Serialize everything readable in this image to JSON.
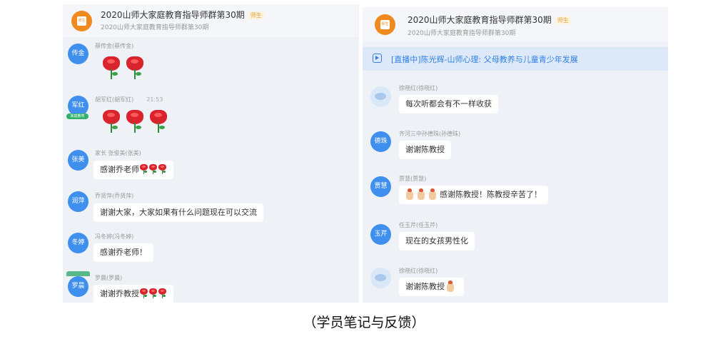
{
  "left_panel": {
    "header": {
      "title": "2020山师大家庭教育指导师群第30期",
      "badge": "师生",
      "subtitle": "2020山师大家庭教育指导师群第30期"
    },
    "messages": [
      {
        "avatar": "传金",
        "name": "蔡传金(蔡传金)"
      },
      {
        "avatar": "军红",
        "avatar_badge": "家庭教育",
        "name": "胡军红(胡军红)",
        "time": "21:53"
      },
      {
        "avatar": "张美",
        "name": "家长 张俊美(张美)",
        "text": "感谢乔老师"
      },
      {
        "avatar": "润萍",
        "name": "乔贤萍(乔贤萍)",
        "text": "谢谢大家，大家如果有什么问题现在可以交流"
      },
      {
        "avatar": "冬婷",
        "name": "冯冬婷(冯冬婷)",
        "text": "感谢乔老师！"
      },
      {
        "avatar": "罗晨",
        "name": "罗晨(罗晨)",
        "text": "谢谢乔教授"
      }
    ]
  },
  "right_panel": {
    "header": {
      "title": "2020山师大家庭教育指导师群第30期",
      "badge": "师生",
      "subtitle": "2020山师大家庭教育指导师群第30期"
    },
    "live_banner": "[直播中]陈光辉-山师心理: 父母教养与儿童青少年发展",
    "messages": [
      {
        "name": "徐晓红(徐晓红)",
        "text": "每次听都会有不一样收获"
      },
      {
        "avatar": "德珠",
        "name": "齐河三中孙德珠(孙德珠)",
        "text": "谢谢陈教授"
      },
      {
        "avatar": "贾慧",
        "name": "贾慧(贾慧)",
        "text": "感谢陈教授！陈教授辛苦了！"
      },
      {
        "avatar": "玉芹",
        "name": "任玉芹(任玉芹)",
        "text": "现在的女孩男性化"
      },
      {
        "name": "徐晓红(徐晓红)",
        "text": "谢谢陈教授"
      }
    ]
  },
  "caption": "（学员笔记与反馈）"
}
